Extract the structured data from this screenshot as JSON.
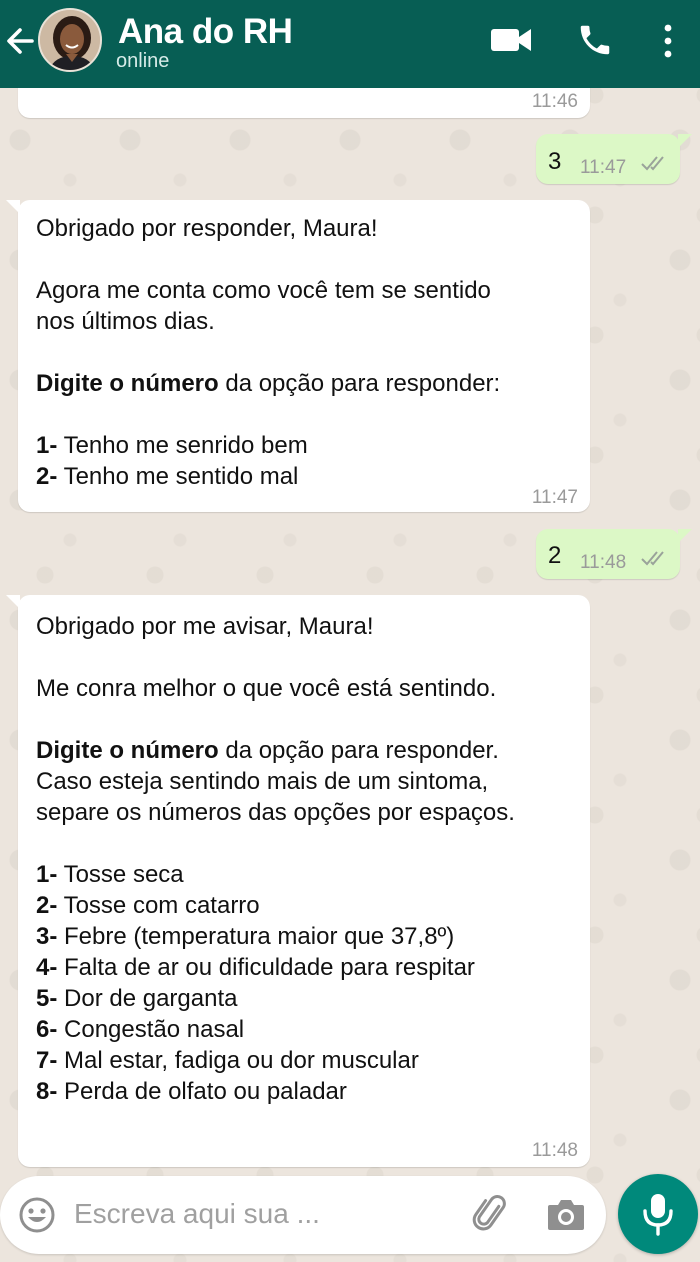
{
  "header": {
    "contact_name": "Ana do RH",
    "status": "online"
  },
  "messages": [
    {
      "direction": "in",
      "partial": true,
      "time": "11:46"
    },
    {
      "direction": "out",
      "text": "3",
      "time": "11:47",
      "status": "read"
    },
    {
      "direction": "in",
      "lines": [
        "Obrigado por responder, Maura!",
        "",
        "Agora me conta como você tem se sentido",
        "nos últimos dias.",
        "",
        "|Digite o número| da opção para responder:",
        "",
        "|1-| Tenho me senrido bem",
        "|2-| Tenho me sentido mal"
      ],
      "time": "11:47"
    },
    {
      "direction": "out",
      "text": "2",
      "time": "11:48",
      "status": "read"
    },
    {
      "direction": "in",
      "lines": [
        "Obrigado por me avisar, Maura!",
        "",
        "Me conra melhor o que você está sentindo.",
        "",
        "|Digite o número| da opção para responder.",
        "Caso esteja sentindo mais de um sintoma,",
        "separe os números das opções por espaços.",
        "",
        "|1-| Tosse seca",
        "|2-| Tosse com catarro",
        "|3-| Febre (temperatura maior que 37,8º)",
        "|4-| Falta de ar ou dificuldade para respitar",
        "|5-| Dor de garganta",
        "|6-| Congestão nasal",
        "|7-| Mal estar, fadiga ou dor muscular",
        "|8-| Perda de olfato ou paladar"
      ],
      "time": "11:48"
    }
  ],
  "input": {
    "placeholder": "Escreva aqui sua ..."
  },
  "icons": {
    "back": "arrow-left-icon",
    "video": "video-camera-icon",
    "call": "phone-icon",
    "menu": "more-vertical-icon",
    "emoji": "smiley-icon",
    "attach": "paperclip-icon",
    "camera": "camera-icon",
    "mic": "microphone-icon"
  },
  "colors": {
    "header": "#075e54",
    "outgoing_bubble": "#dcf8c6",
    "incoming_bubble": "#ffffff",
    "mic_button": "#00897b",
    "background": "#ece5dd"
  }
}
